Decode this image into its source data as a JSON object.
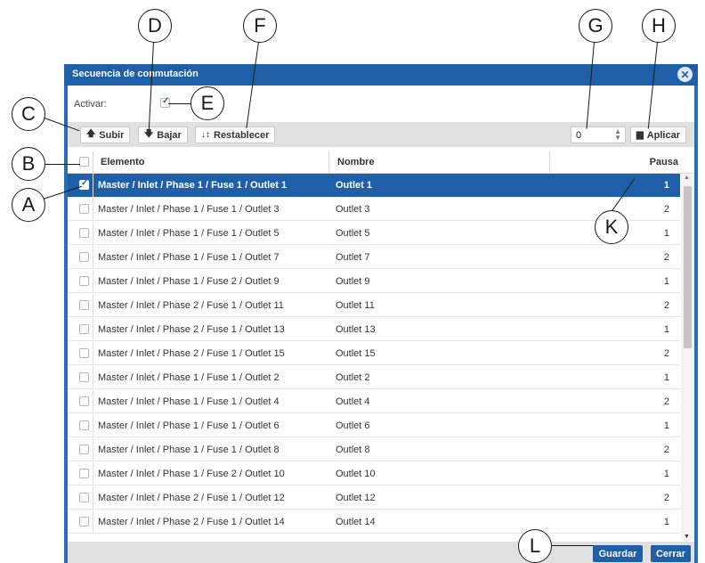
{
  "dialog": {
    "title": "Secuencia de conmutación",
    "close_icon": "close-circle-icon",
    "activar_label": "Activar:",
    "activar_checked": true
  },
  "toolbar": {
    "subir_label": "Subir",
    "subir_icon": "arrow-up-icon",
    "bajar_label": "Bajar",
    "bajar_icon": "arrow-down-icon",
    "restablecer_label": "Restablecer",
    "restablecer_icon": "sort-icon",
    "spinner_value": "0",
    "aplicar_label": "Aplicar",
    "aplicar_icon": "copy-icon"
  },
  "table": {
    "headers": {
      "elemento": "Elemento",
      "nombre": "Nombre",
      "pausa": "Pausa"
    },
    "rows": [
      {
        "elemento": "Master / Inlet / Phase 1 / Fuse 1 / Outlet 1",
        "nombre": "Outlet 1",
        "pausa": "1",
        "selected": true
      },
      {
        "elemento": "Master / Inlet / Phase 1 / Fuse 1 / Outlet 3",
        "nombre": "Outlet 3",
        "pausa": "2",
        "selected": false
      },
      {
        "elemento": "Master / Inlet / Phase 1 / Fuse 1 / Outlet 5",
        "nombre": "Outlet 5",
        "pausa": "1",
        "selected": false
      },
      {
        "elemento": "Master / Inlet / Phase 1 / Fuse 1 / Outlet 7",
        "nombre": "Outlet 7",
        "pausa": "2",
        "selected": false
      },
      {
        "elemento": "Master / Inlet / Phase 1 / Fuse 2 / Outlet 9",
        "nombre": "Outlet 9",
        "pausa": "1",
        "selected": false
      },
      {
        "elemento": "Master / Inlet / Phase 2 / Fuse 1 / Outlet 11",
        "nombre": "Outlet 11",
        "pausa": "2",
        "selected": false
      },
      {
        "elemento": "Master / Inlet / Phase 2 / Fuse 1 / Outlet 13",
        "nombre": "Outlet 13",
        "pausa": "1",
        "selected": false
      },
      {
        "elemento": "Master / Inlet / Phase 2 / Fuse 1 / Outlet 15",
        "nombre": "Outlet 15",
        "pausa": "2",
        "selected": false
      },
      {
        "elemento": "Master / Inlet / Phase 1 / Fuse 1 / Outlet 2",
        "nombre": "Outlet 2",
        "pausa": "1",
        "selected": false
      },
      {
        "elemento": "Master / Inlet / Phase 1 / Fuse 1 / Outlet 4",
        "nombre": "Outlet 4",
        "pausa": "2",
        "selected": false
      },
      {
        "elemento": "Master / Inlet / Phase 1 / Fuse 1 / Outlet 6",
        "nombre": "Outlet 6",
        "pausa": "1",
        "selected": false
      },
      {
        "elemento": "Master / Inlet / Phase 1 / Fuse 1 / Outlet 8",
        "nombre": "Outlet 8",
        "pausa": "2",
        "selected": false
      },
      {
        "elemento": "Master / Inlet / Phase 1 / Fuse 2 / Outlet 10",
        "nombre": "Outlet 10",
        "pausa": "1",
        "selected": false
      },
      {
        "elemento": "Master / Inlet / Phase 2 / Fuse 1 / Outlet 12",
        "nombre": "Outlet 12",
        "pausa": "2",
        "selected": false
      },
      {
        "elemento": "Master / Inlet / Phase 2 / Fuse 1 / Outlet 14",
        "nombre": "Outlet 14",
        "pausa": "1",
        "selected": false
      }
    ]
  },
  "footer": {
    "guardar_label": "Guardar",
    "cerrar_label": "Cerrar"
  },
  "callouts": {
    "a": "A",
    "b": "B",
    "c": "C",
    "d": "D",
    "e": "E",
    "f": "F",
    "g": "G",
    "h": "H",
    "k": "K",
    "l": "L"
  },
  "colors": {
    "header_blue": "#1f5fa7",
    "toolbar_gray": "#e1e1e1",
    "selected_row": "#1f5fa7"
  }
}
